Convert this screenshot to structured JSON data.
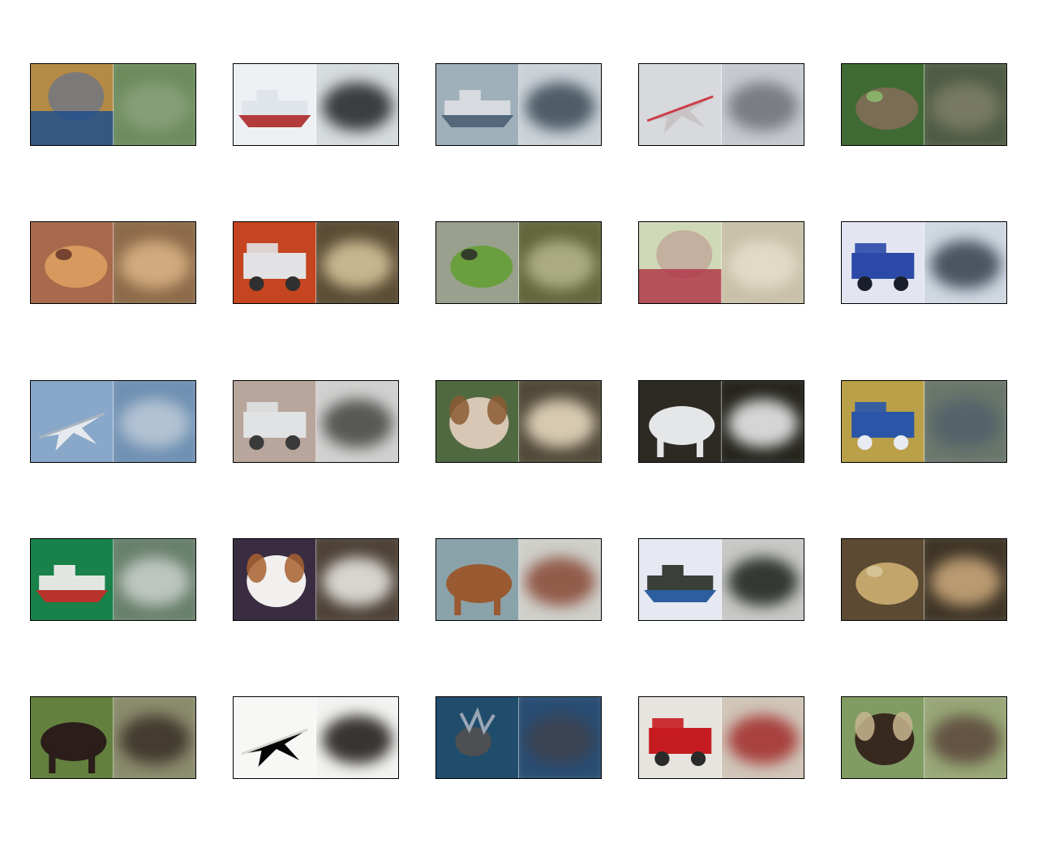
{
  "figure": {
    "rows": 5,
    "cols": 5,
    "panels": [
      {
        "subject": "cat",
        "original_colors": {
          "bg": "#b58a45",
          "fg": "#7c7a78",
          "accent": "#1f4f8c"
        },
        "recon_colors": {
          "bg": "#6c8b5d",
          "fg": "#8aa07b"
        }
      },
      {
        "subject": "ship",
        "original_colors": {
          "bg": "#eef1f3",
          "fg": "#dfe5ea",
          "accent": "#b33b3c"
        },
        "recon_colors": {
          "bg": "#d6dbdd",
          "fg": "#2a2c2e"
        }
      },
      {
        "subject": "ship",
        "original_colors": {
          "bg": "#9fb0bb",
          "fg": "#d7dbe0",
          "accent": "#53687a"
        },
        "recon_colors": {
          "bg": "#cbd2d8",
          "fg": "#40505b"
        }
      },
      {
        "subject": "airplane",
        "original_colors": {
          "bg": "#d7d9dc",
          "fg": "#c8c4c6",
          "accent": "#cc3d48"
        },
        "recon_colors": {
          "bg": "#c6cad0",
          "fg": "#71767b"
        }
      },
      {
        "subject": "frog",
        "original_colors": {
          "bg": "#3f6a34",
          "fg": "#7b6c54",
          "accent": "#8ab86a"
        },
        "recon_colors": {
          "bg": "#4f5b43",
          "fg": "#7b7c66"
        }
      },
      {
        "subject": "frog",
        "original_colors": {
          "bg": "#a86a4c",
          "fg": "#d7995d",
          "accent": "#6b3a2c"
        },
        "recon_colors": {
          "bg": "#8c6a49",
          "fg": "#d8b383"
        }
      },
      {
        "subject": "automobile",
        "original_colors": {
          "bg": "#c4451f",
          "fg": "#e2e2e4",
          "accent": "#303030"
        },
        "recon_colors": {
          "bg": "#5a4b34",
          "fg": "#d3c197"
        }
      },
      {
        "subject": "frog",
        "original_colors": {
          "bg": "#9aa08e",
          "fg": "#6a9f3f",
          "accent": "#2c3128"
        },
        "recon_colors": {
          "bg": "#62663c",
          "fg": "#b3b28a"
        }
      },
      {
        "subject": "cat",
        "original_colors": {
          "bg": "#cfd9b8",
          "fg": "#c4b09e",
          "accent": "#b03a49"
        },
        "recon_colors": {
          "bg": "#c8c0a7",
          "fg": "#e3ddcb"
        }
      },
      {
        "subject": "automobile",
        "original_colors": {
          "bg": "#e3e6f1",
          "fg": "#2b4aa8",
          "accent": "#1b1f2b"
        },
        "recon_colors": {
          "bg": "#cfd7e1",
          "fg": "#3d4752"
        }
      },
      {
        "subject": "airplane",
        "original_colors": {
          "bg": "#88a7c9",
          "fg": "#e6e9ee",
          "accent": "#a8b4c1"
        },
        "recon_colors": {
          "bg": "#6f90b2",
          "fg": "#b9c8d6"
        }
      },
      {
        "subject": "truck",
        "original_colors": {
          "bg": "#b8a59b",
          "fg": "#e1e2e3",
          "accent": "#3a3a3a"
        },
        "recon_colors": {
          "bg": "#d0d0cf",
          "fg": "#4a4b48"
        }
      },
      {
        "subject": "dog",
        "original_colors": {
          "bg": "#516941",
          "fg": "#d8c7b5",
          "accent": "#8b5a33"
        },
        "recon_colors": {
          "bg": "#504838",
          "fg": "#e5d8bf"
        }
      },
      {
        "subject": "horse",
        "original_colors": {
          "bg": "#2c2a23",
          "fg": "#e4e6e8",
          "accent": "#14130f"
        },
        "recon_colors": {
          "bg": "#24231c",
          "fg": "#e9e9ea"
        }
      },
      {
        "subject": "truck",
        "original_colors": {
          "bg": "#bba04a",
          "fg": "#2b56a8",
          "accent": "#e8ebf2"
        },
        "recon_colors": {
          "bg": "#69766b",
          "fg": "#52626a"
        }
      },
      {
        "subject": "ship",
        "original_colors": {
          "bg": "#18824a",
          "fg": "#e2e6e2",
          "accent": "#b6322a"
        },
        "recon_colors": {
          "bg": "#67806b",
          "fg": "#c7ccca"
        }
      },
      {
        "subject": "dog",
        "original_colors": {
          "bg": "#3a2c41",
          "fg": "#f2f0ee",
          "accent": "#a86230"
        },
        "recon_colors": {
          "bg": "#4d4137",
          "fg": "#e7e5e1"
        }
      },
      {
        "subject": "horse",
        "original_colors": {
          "bg": "#8aa3aa",
          "fg": "#9a5a31",
          "accent": "#e5e1dc"
        },
        "recon_colors": {
          "bg": "#cfcfca",
          "fg": "#8b4e3c"
        }
      },
      {
        "subject": "ship",
        "original_colors": {
          "bg": "#e6e8f2",
          "fg": "#3a3f39",
          "accent": "#2d5ea0"
        },
        "recon_colors": {
          "bg": "#c7c8c5",
          "fg": "#222824"
        }
      },
      {
        "subject": "frog",
        "original_colors": {
          "bg": "#5c4a32",
          "fg": "#c2a56b",
          "accent": "#d7c79a"
        },
        "recon_colors": {
          "bg": "#3f3526",
          "fg": "#c6a57a"
        }
      },
      {
        "subject": "horse",
        "original_colors": {
          "bg": "#63803e",
          "fg": "#2a1d1a",
          "accent": "#d8d8d7"
        },
        "recon_colors": {
          "bg": "#8a8a6c",
          "fg": "#3b3329"
        }
      },
      {
        "subject": "airplane",
        "original_colors": {
          "bg": "#f7f8f6",
          "fg": "#050505",
          "accent": "#d5d8d1"
        },
        "recon_colors": {
          "bg": "#f2f3f1",
          "fg": "#241f1c"
        }
      },
      {
        "subject": "deer",
        "original_colors": {
          "bg": "#214d6c",
          "fg": "#4d4f52",
          "accent": "#9aa6b5"
        },
        "recon_colors": {
          "bg": "#284c73",
          "fg": "#3d4250"
        }
      },
      {
        "subject": "truck",
        "original_colors": {
          "bg": "#e7e4df",
          "fg": "#c61c21",
          "accent": "#2a2a2a"
        },
        "recon_colors": {
          "bg": "#d0c5b8",
          "fg": "#a33232"
        }
      },
      {
        "subject": "dog",
        "original_colors": {
          "bg": "#809c63",
          "fg": "#38291f",
          "accent": "#c8b58f"
        },
        "recon_colors": {
          "bg": "#98a677",
          "fg": "#5d4b3d"
        }
      }
    ]
  }
}
